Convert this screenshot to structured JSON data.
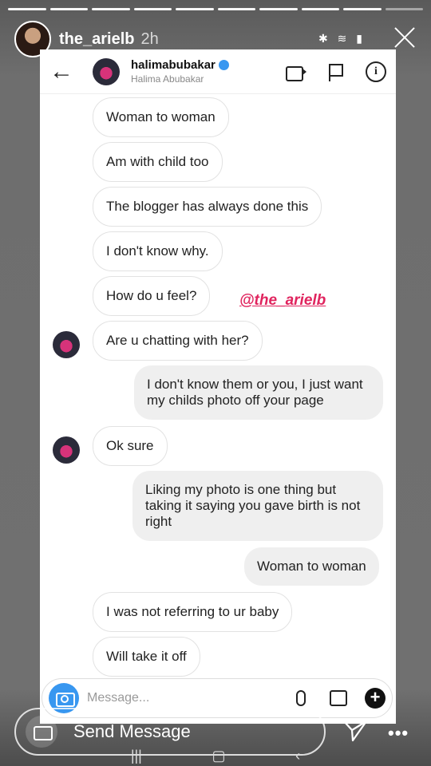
{
  "story": {
    "username": "the_arielb",
    "time": "2h",
    "reply_label": "Send Message"
  },
  "dm": {
    "handle": "halimabubakar",
    "full_name": "Halima Abubakar"
  },
  "watermark": "@the_arielb",
  "messages": [
    {
      "side": "in",
      "text": "Woman to woman"
    },
    {
      "side": "in",
      "text": "Am with child too"
    },
    {
      "side": "in",
      "text": "The blogger has always done this"
    },
    {
      "side": "in",
      "text": "I don't know why."
    },
    {
      "side": "in",
      "text": "How do u feel?"
    },
    {
      "side": "in",
      "text": "Are u chatting with her?"
    },
    {
      "side": "out",
      "text": "I don't know them or you, I just want my childs photo off your page"
    },
    {
      "side": "in",
      "text": "Ok sure"
    },
    {
      "side": "out",
      "text": "Liking my photo is one thing but taking it saying you gave birth is not right"
    },
    {
      "side": "out",
      "text": "Woman to woman"
    },
    {
      "side": "in",
      "text": "I was not referring to ur baby"
    },
    {
      "side": "in",
      "text": "Will take it off"
    }
  ],
  "composer": {
    "placeholder": "Message..."
  }
}
